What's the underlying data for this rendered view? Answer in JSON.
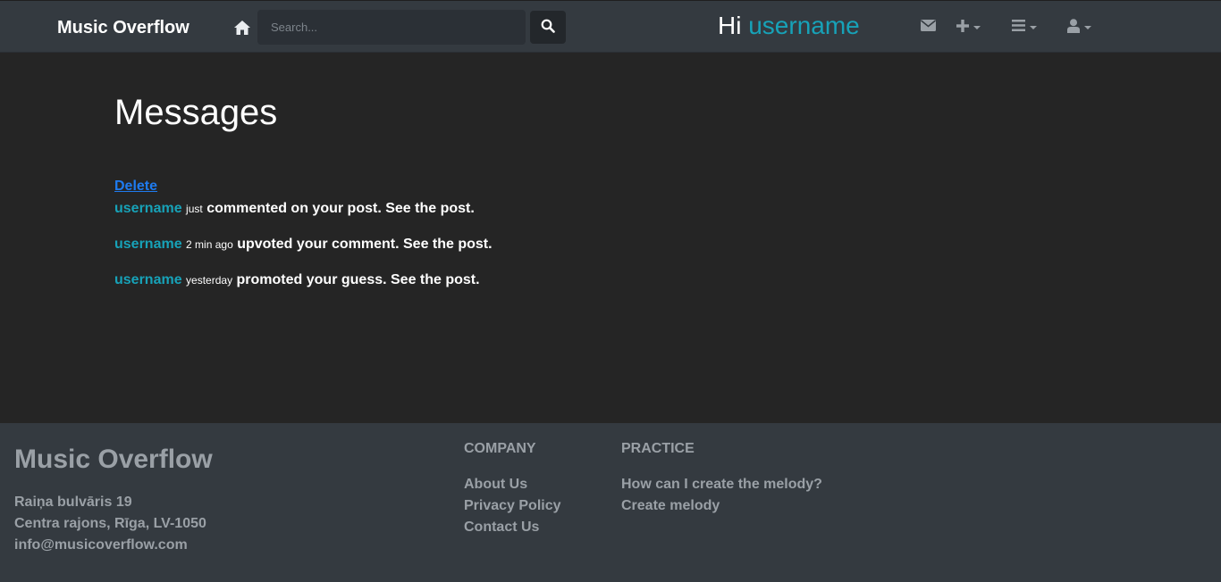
{
  "navbar": {
    "brand": "Music Overflow",
    "search_placeholder": "Search...",
    "greeting_prefix": "Hi",
    "greeting_username": "username"
  },
  "main": {
    "title": "Messages",
    "delete_label": "Delete",
    "messages": [
      {
        "user": "username",
        "time": "just",
        "text": "commented on your post. See the post."
      },
      {
        "user": "username",
        "time": "2 min ago",
        "text": "upvoted your comment. See the post."
      },
      {
        "user": "username",
        "time": "yesterday",
        "text": "promoted your guess. See the post."
      }
    ]
  },
  "footer": {
    "brand": "Music Overflow",
    "address_line1": "Raiņa bulvāris 19",
    "address_line2": "Centra rajons, Rīga, LV-1050",
    "email": "info@musicoverflow.com",
    "company": {
      "heading": "COMPANY",
      "links": [
        "About Us",
        "Privacy Policy",
        "Contact Us"
      ]
    },
    "practice": {
      "heading": "PRACTICE",
      "links": [
        "How can I create the melody?",
        "Create melody"
      ]
    }
  },
  "colors": {
    "accent": "#17a2b8",
    "link": "#1e7bf0",
    "navbar_bg": "#343a40",
    "page_bg": "#252525",
    "footer_text": "#9aa0a6"
  },
  "icons": [
    "home-icon",
    "search-icon",
    "envelope-icon",
    "plus-icon",
    "menu-icon",
    "user-icon"
  ]
}
